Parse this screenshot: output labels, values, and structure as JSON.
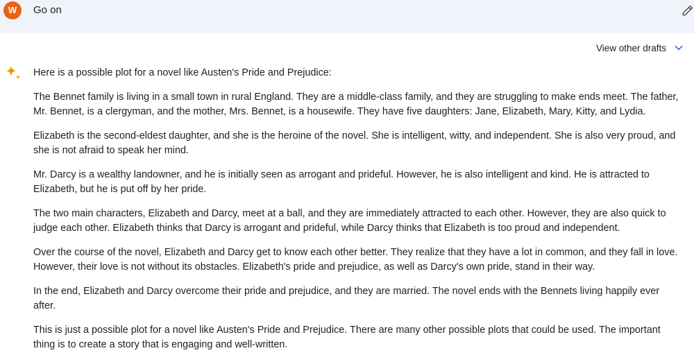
{
  "prompt": {
    "avatar_letter": "W",
    "text": "Go on",
    "avatar_color": "#e8631a"
  },
  "drafts": {
    "label": "View other drafts"
  },
  "response": {
    "paragraphs": [
      "Here is a possible plot for a novel like Austen's Pride and Prejudice:",
      "The Bennet family is living in a small town in rural England. They are a middle-class family, and they are struggling to make ends meet. The father, Mr. Bennet, is a clergyman, and the mother, Mrs. Bennet, is a housewife. They have five daughters: Jane, Elizabeth, Mary, Kitty, and Lydia.",
      "Elizabeth is the second-eldest daughter, and she is the heroine of the novel. She is intelligent, witty, and independent. She is also very proud, and she is not afraid to speak her mind.",
      "Mr. Darcy is a wealthy landowner, and he is initially seen as arrogant and prideful. However, he is also intelligent and kind. He is attracted to Elizabeth, but he is put off by her pride.",
      "The two main characters, Elizabeth and Darcy, meet at a ball, and they are immediately attracted to each other. However, they are also quick to judge each other. Elizabeth thinks that Darcy is arrogant and prideful, while Darcy thinks that Elizabeth is too proud and independent.",
      "Over the course of the novel, Elizabeth and Darcy get to know each other better. They realize that they have a lot in common, and they fall in love. However, their love is not without its obstacles. Elizabeth's pride and prejudice, as well as Darcy's own pride, stand in their way.",
      "In the end, Elizabeth and Darcy overcome their pride and prejudice, and they are married. The novel ends with the Bennets living happily ever after.",
      "This is just a possible plot for a novel like Austen's Pride and Prejudice. There are many other possible plots that could be used. The important thing is to create a story that is engaging and well-written."
    ]
  },
  "icons": {
    "edit": "pencil-icon",
    "drafts_toggle": "chevron-down-icon",
    "assistant": "sparkle-icon"
  },
  "colors": {
    "prompt_background": "#f1f3fb",
    "accent_blue": "#1a73e8"
  }
}
